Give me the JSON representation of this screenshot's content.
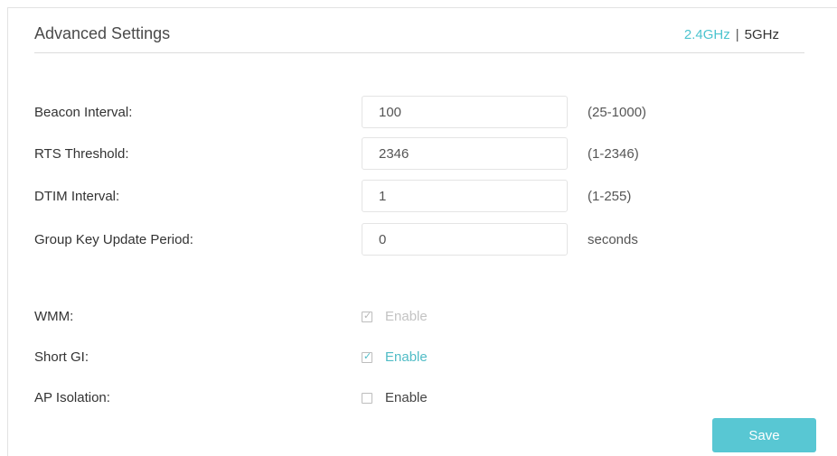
{
  "header": {
    "title": "Advanced Settings",
    "band_24": "2.4GHz",
    "band_separator": "|",
    "band_5": "5GHz",
    "active_band": "2.4GHz"
  },
  "fields": {
    "beacon_interval": {
      "label": "Beacon Interval:",
      "value": "100",
      "hint": "(25-1000)"
    },
    "rts_threshold": {
      "label": "RTS Threshold:",
      "value": "2346",
      "hint": "(1-2346)"
    },
    "dtim_interval": {
      "label": "DTIM Interval:",
      "value": "1",
      "hint": "(1-255)"
    },
    "group_key_update": {
      "label": "Group Key Update Period:",
      "value": "0",
      "hint": "seconds"
    }
  },
  "options": {
    "wmm": {
      "label": "WMM:",
      "checkbox_text": "Enable",
      "checked": true,
      "disabled": true
    },
    "short_gi": {
      "label": "Short GI:",
      "checkbox_text": "Enable",
      "checked": true,
      "disabled": false
    },
    "ap_isolation": {
      "label": "AP Isolation:",
      "checkbox_text": "Enable",
      "checked": false,
      "disabled": false
    }
  },
  "actions": {
    "save_label": "Save"
  },
  "colors": {
    "accent": "#50bcc6",
    "save_button": "#58c7d3",
    "disabled_text": "#c3c3c3"
  }
}
